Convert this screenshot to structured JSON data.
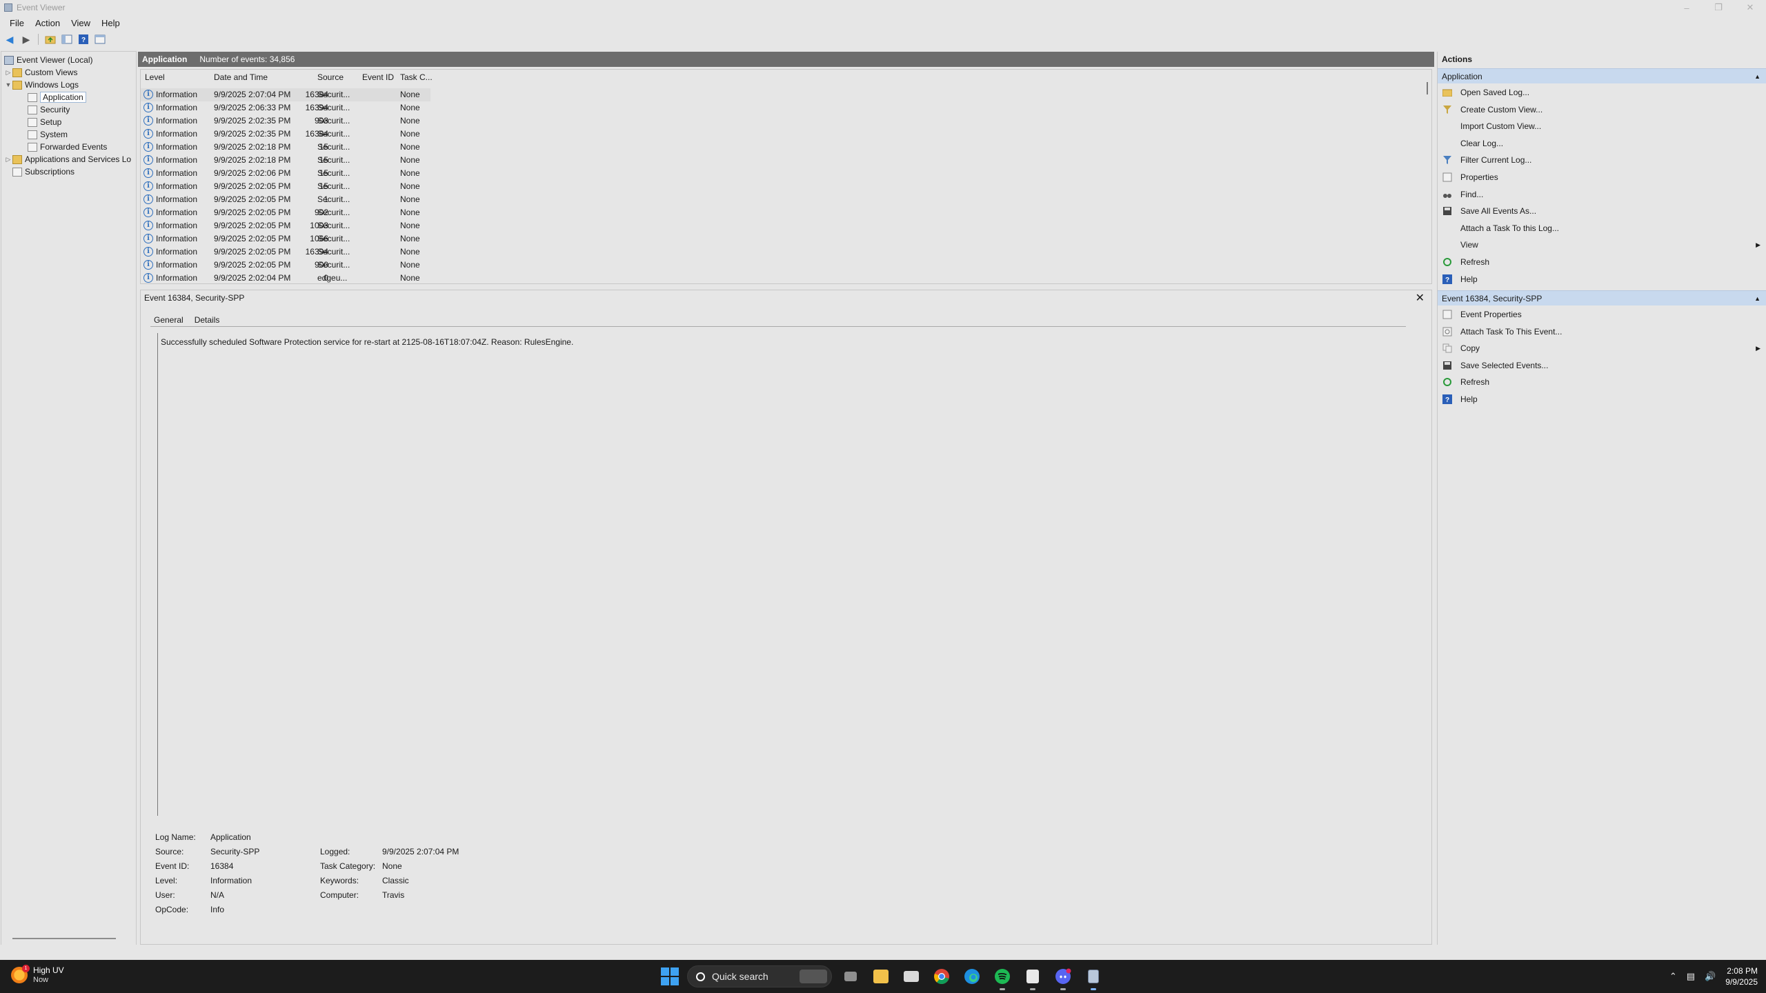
{
  "window": {
    "title": "Event Viewer"
  },
  "menu": [
    "File",
    "Action",
    "View",
    "Help"
  ],
  "tree": {
    "root": "Event Viewer (Local)",
    "custom_views": "Custom Views",
    "windows_logs": "Windows Logs",
    "logs": [
      "Application",
      "Security",
      "Setup",
      "System",
      "Forwarded Events"
    ],
    "apps_services": "Applications and Services Lo",
    "subscriptions": "Subscriptions"
  },
  "list": {
    "log_name": "Application",
    "count_text": "Number of events: 34,856",
    "columns": [
      "Level",
      "Date and Time",
      "Source",
      "Event ID",
      "Task C..."
    ],
    "rows": [
      {
        "level": "Information",
        "date": "9/9/2025 2:07:04 PM",
        "source": "Securit...",
        "id": "16384",
        "task": "None"
      },
      {
        "level": "Information",
        "date": "9/9/2025 2:06:33 PM",
        "source": "Securit...",
        "id": "16394",
        "task": "None"
      },
      {
        "level": "Information",
        "date": "9/9/2025 2:02:35 PM",
        "source": "Securit...",
        "id": "903",
        "task": "None"
      },
      {
        "level": "Information",
        "date": "9/9/2025 2:02:35 PM",
        "source": "Securit...",
        "id": "16384",
        "task": "None"
      },
      {
        "level": "Information",
        "date": "9/9/2025 2:02:18 PM",
        "source": "Securit...",
        "id": "15",
        "task": "None"
      },
      {
        "level": "Information",
        "date": "9/9/2025 2:02:18 PM",
        "source": "Securit...",
        "id": "15",
        "task": "None"
      },
      {
        "level": "Information",
        "date": "9/9/2025 2:02:06 PM",
        "source": "Securit...",
        "id": "15",
        "task": "None"
      },
      {
        "level": "Information",
        "date": "9/9/2025 2:02:05 PM",
        "source": "Securit...",
        "id": "15",
        "task": "None"
      },
      {
        "level": "Information",
        "date": "9/9/2025 2:02:05 PM",
        "source": "Securit...",
        "id": "1",
        "task": "None"
      },
      {
        "level": "Information",
        "date": "9/9/2025 2:02:05 PM",
        "source": "Securit...",
        "id": "902",
        "task": "None"
      },
      {
        "level": "Information",
        "date": "9/9/2025 2:02:05 PM",
        "source": "Securit...",
        "id": "1003",
        "task": "None"
      },
      {
        "level": "Information",
        "date": "9/9/2025 2:02:05 PM",
        "source": "Securit...",
        "id": "1066",
        "task": "None"
      },
      {
        "level": "Information",
        "date": "9/9/2025 2:02:05 PM",
        "source": "Securit...",
        "id": "16394",
        "task": "None"
      },
      {
        "level": "Information",
        "date": "9/9/2025 2:02:05 PM",
        "source": "Securit...",
        "id": "900",
        "task": "None"
      },
      {
        "level": "Information",
        "date": "9/9/2025 2:02:04 PM",
        "source": "edgeu...",
        "id": "0",
        "task": "None"
      }
    ]
  },
  "detail": {
    "title": "Event 16384, Security-SPP",
    "tabs": [
      "General",
      "Details"
    ],
    "description": "Successfully scheduled Software Protection service for re-start at 2125-08-16T18:07:04Z. Reason: RulesEngine.",
    "props_left": [
      {
        "label": "Log Name:",
        "value": "Application"
      },
      {
        "label": "Source:",
        "value": "Security-SPP"
      },
      {
        "label": "Event ID:",
        "value": "16384"
      },
      {
        "label": "Level:",
        "value": "Information"
      },
      {
        "label": "User:",
        "value": "N/A"
      },
      {
        "label": "OpCode:",
        "value": "Info"
      }
    ],
    "props_right": [
      {
        "label": "Logged:",
        "value": "9/9/2025 2:07:04 PM"
      },
      {
        "label": "Task Category:",
        "value": "None"
      },
      {
        "label": "Keywords:",
        "value": "Classic"
      },
      {
        "label": "Computer:",
        "value": "Travis"
      }
    ]
  },
  "actions": {
    "header": "Actions",
    "section1": "Application",
    "items1": [
      {
        "label": "Open Saved Log...",
        "icon": "folder-open-icon"
      },
      {
        "label": "Create Custom View...",
        "icon": "filter-star-icon"
      },
      {
        "label": "Import Custom View...",
        "icon": ""
      },
      {
        "label": "Clear Log...",
        "icon": ""
      },
      {
        "label": "Filter Current Log...",
        "icon": "filter-icon"
      },
      {
        "label": "Properties",
        "icon": "properties-icon"
      },
      {
        "label": "Find...",
        "icon": "binoculars-icon"
      },
      {
        "label": "Save All Events As...",
        "icon": "save-icon"
      },
      {
        "label": "Attach a Task To this Log...",
        "icon": ""
      },
      {
        "label": "View",
        "icon": "",
        "submenu": true
      },
      {
        "label": "Refresh",
        "icon": "refresh-icon"
      },
      {
        "label": "Help",
        "icon": "help-icon"
      }
    ],
    "section2": "Event 16384, Security-SPP",
    "items2": [
      {
        "label": "Event Properties",
        "icon": "properties-icon"
      },
      {
        "label": "Attach Task To This Event...",
        "icon": "task-icon"
      },
      {
        "label": "Copy",
        "icon": "copy-icon",
        "submenu": true
      },
      {
        "label": "Save Selected Events...",
        "icon": "save-icon"
      },
      {
        "label": "Refresh",
        "icon": "refresh-icon"
      },
      {
        "label": "Help",
        "icon": "help-icon"
      }
    ]
  },
  "taskbar": {
    "weather_title": "High UV",
    "weather_sub": "Now",
    "weather_badge": "1",
    "search": "Quick search",
    "time": "2:08 PM",
    "date": "9/9/2025"
  }
}
